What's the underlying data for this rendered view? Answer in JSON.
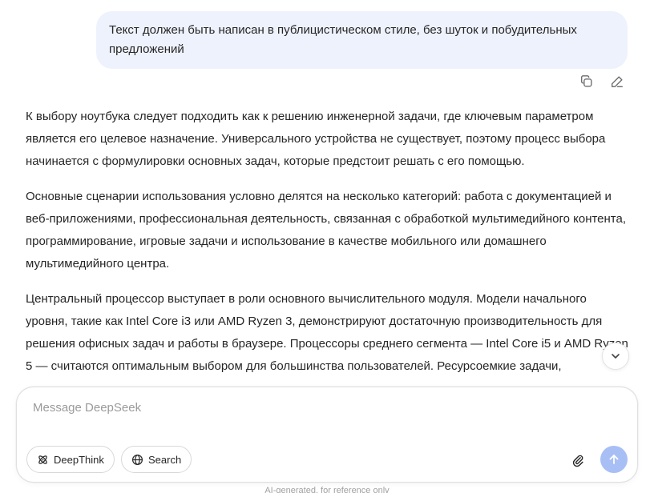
{
  "user_message": {
    "text": "Текст должен быть написан в публицистическом стиле, без шуток и побудительных предложений"
  },
  "message_actions": {
    "copy_icon": "copy-icon",
    "edit_icon": "edit-icon"
  },
  "answer": {
    "paragraphs": [
      "К выбору ноутбука следует подходить как к решению инженерной задачи, где ключевым параметром является его целевое назначение. Универсального устройства не существует, поэтому процесс выбора начинается с формулировки основных задач, которые предстоит решать с его помощью.",
      "Основные сценарии использования условно делятся на несколько категорий: работа с документацией и веб-приложениями, профессиональная деятельность, связанная с обработкой мультимедийного контента, программирование, игровые задачи и использование в качестве мобильного или домашнего мультимедийного центра.",
      "Центральный процессор выступает в роли основного вычислительного модуля. Модели начального уровня, такие как Intel Core i3 или AMD Ryzen 3, демонстрируют достаточную производительность для решения офисных задач и работы в браузере. Процессоры среднего сегмента — Intel Core i5 и AMD Ryzen 5 — считаются оптимальным выбором для большинства пользователей. Ресурсоемкие задачи,"
    ]
  },
  "composer": {
    "placeholder": "Message DeepSeek",
    "deepthink_label": "DeepThink",
    "search_label": "Search"
  },
  "footer": {
    "note": "AI-generated, for reference only"
  },
  "colors": {
    "user_bubble_bg": "#eef2fd",
    "send_button_bg": "#a8bff6",
    "text": "#262626"
  }
}
